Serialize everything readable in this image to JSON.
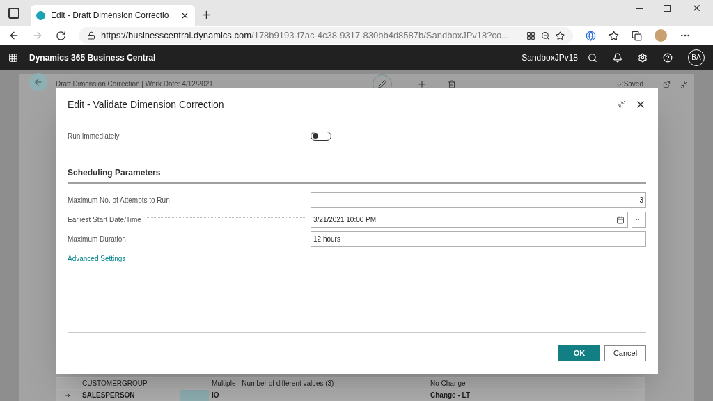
{
  "browser": {
    "tab_title": "Edit - Draft Dimension Correctio",
    "url_host": "https://businesscentral.dynamics.com",
    "url_path": "/178b9193-f7ac-4c38-9317-830bb4d8587b/SandboxJPv18?co..."
  },
  "app_bar": {
    "title": "Dynamics 365 Business Central",
    "environment": "SandboxJPv18",
    "avatar": "BA"
  },
  "page": {
    "title": "Draft Dimension Correction | Work Date: 4/12/2021",
    "status": "Saved",
    "rows": [
      {
        "arrow": false,
        "bold": false,
        "dimension": "CUSTOMERGROUP",
        "value": "Multiple - Number of different values (3)",
        "change": "No Change"
      },
      {
        "arrow": true,
        "bold": true,
        "dimension": "SALESPERSON",
        "value": "IO",
        "change": "Change - LT"
      }
    ]
  },
  "dialog": {
    "title": "Edit - Validate Dimension Correction",
    "toggle": {
      "label": "Run immediately",
      "on": false
    },
    "section": "Scheduling Parameters",
    "fields": [
      {
        "kind": "number",
        "label": "Maximum No. of Attempts to Run",
        "value": "3"
      },
      {
        "kind": "datetime",
        "label": "Earliest Start Date/Time",
        "value": "3/21/2021 10:00 PM",
        "more": "···"
      },
      {
        "kind": "text",
        "label": "Maximum Duration",
        "value": "12 hours"
      }
    ],
    "link": "Advanced Settings",
    "buttons": [
      "OK",
      "Cancel"
    ]
  }
}
